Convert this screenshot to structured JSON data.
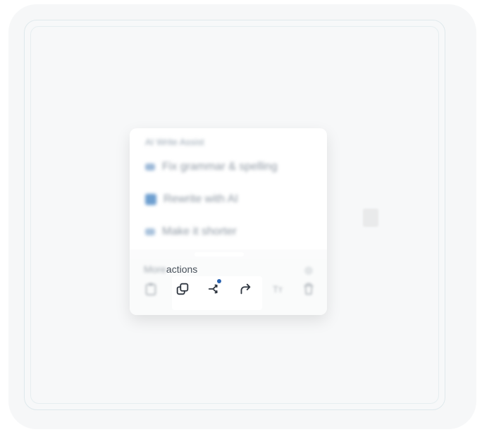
{
  "ai_writer": {
    "header": "AI Write Assist",
    "items": [
      {
        "label": "Fix grammar & spelling",
        "icon": "check-sparkle-icon"
      },
      {
        "label": "Rewrite with AI",
        "icon": "edit-icon"
      },
      {
        "label": "Make it shorter",
        "icon": "shorten-icon"
      }
    ]
  },
  "more_actions": {
    "title_prefix": "More",
    "title_suffix": "actions",
    "buttons": [
      {
        "name": "clipboard-icon"
      },
      {
        "name": "duplicate-icon"
      },
      {
        "name": "branch-icon",
        "badge_color": "#2a63b0"
      },
      {
        "name": "forward-icon"
      },
      {
        "name": "text-size-icon",
        "label": "Tт"
      },
      {
        "name": "trash-icon"
      }
    ]
  },
  "colors": {
    "accent": "#2a63b0",
    "icon": "#2f3640"
  }
}
